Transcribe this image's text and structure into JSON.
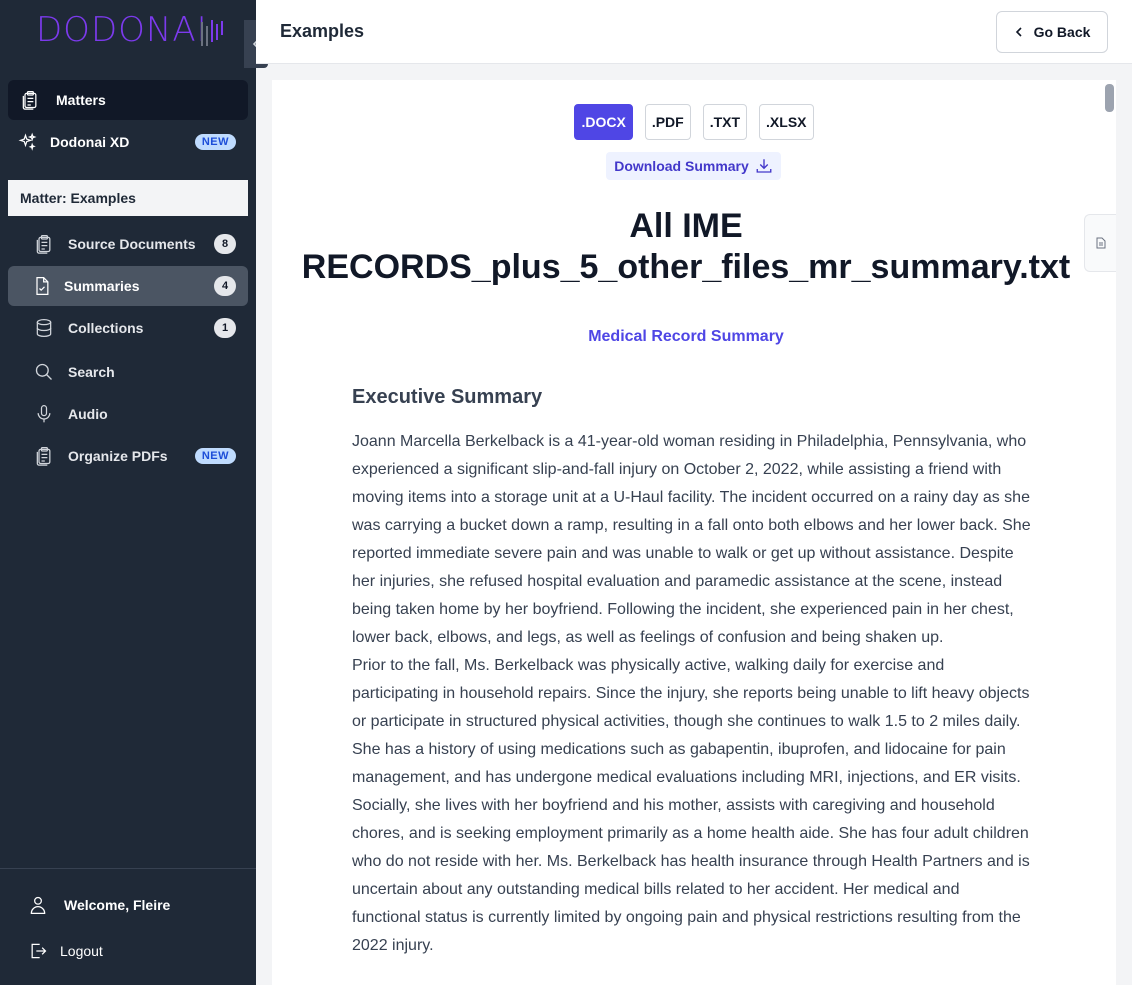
{
  "brand": {
    "name": "DODONAI"
  },
  "sidebar": {
    "main_items": [
      {
        "label": "Matters",
        "icon": "clipboard-icon",
        "active": true
      },
      {
        "label": "Dodonai XD",
        "icon": "sparkles-icon",
        "badge": "NEW"
      }
    ],
    "matter_header": "Matter: Examples",
    "sub_items": [
      {
        "label": "Source Documents",
        "icon": "clipboard-icon",
        "count": "8"
      },
      {
        "label": "Summaries",
        "icon": "document-icon",
        "count": "4",
        "active": true
      },
      {
        "label": "Collections",
        "icon": "database-icon",
        "count": "1"
      },
      {
        "label": "Search",
        "icon": "search-icon"
      },
      {
        "label": "Audio",
        "icon": "microphone-icon"
      },
      {
        "label": "Organize PDFs",
        "icon": "clipboard-icon",
        "badge": "NEW"
      }
    ],
    "welcome": "Welcome, Fleire",
    "logout": "Logout"
  },
  "header": {
    "title": "Examples",
    "go_back": "Go Back"
  },
  "formats": [
    ".DOCX",
    ".PDF",
    ".TXT",
    ".XLSX"
  ],
  "selected_format": ".DOCX",
  "download_label": "Download Summary",
  "document": {
    "title_line1": "All IME",
    "title_line2": "RECORDS_plus_5_other_files_mr_summary.txt",
    "subtitle": "Medical Record Summary",
    "section_heading": "Executive Summary",
    "paragraphs": [
      "Joann Marcella Berkelback is a 41-year-old woman residing in Philadelphia, Pennsylvania, who experienced a significant slip-and-fall injury on October 2, 2022, while assisting a friend with moving items into a storage unit at a U-Haul facility. The incident occurred on a rainy day as she was carrying a bucket down a ramp, resulting in a fall onto both elbows and her lower back. She reported immediate severe pain and was unable to walk or get up without assistance. Despite her injuries, she refused hospital evaluation and paramedic assistance at the scene, instead being taken home by her boyfriend. Following the incident, she experienced pain in her chest, lower back, elbows, and legs, as well as feelings of confusion and being shaken up.",
      "Prior to the fall, Ms. Berkelback was physically active, walking daily for exercise and participating in household repairs. Since the injury, she reports being unable to lift heavy objects or participate in structured physical activities, though she continues to walk 1.5 to 2 miles daily. She has a history of using medications such as gabapentin, ibuprofen, and lidocaine for pain management, and has undergone medical evaluations including MRI, injections, and ER visits. Socially, she lives with her boyfriend and his mother, assists with caregiving and household chores, and is seeking employment primarily as a home health aide. She has four adult children who do not reside with her. Ms. Berkelback has health insurance through Health Partners and is uncertain about any outstanding medical bills related to her accident. Her medical and functional status is currently limited by ongoing pain and physical restrictions resulting from the 2022 injury."
    ]
  },
  "colors": {
    "sidebar": "#1f2937",
    "accent": "#4f46e5",
    "logo": "#7c3aed"
  }
}
